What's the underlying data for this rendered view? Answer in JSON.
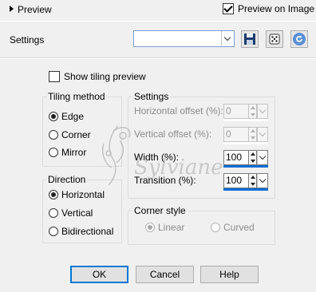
{
  "preview_bar": {
    "toggle_label": "Preview",
    "preview_on_image_label": "Preview on Image",
    "preview_on_image_checked": true
  },
  "settings_row": {
    "label": "Settings",
    "preset_value": "",
    "buttons": {
      "save": "save-icon",
      "random": "dice-icon",
      "reset": "reset-icon"
    }
  },
  "show_tiling_preview": {
    "label": "Show tiling preview",
    "checked": false
  },
  "tiling_method": {
    "title": "Tiling method",
    "options": [
      {
        "label": "Edge",
        "selected": true
      },
      {
        "label": "Corner",
        "selected": false
      },
      {
        "label": "Mirror",
        "selected": false
      }
    ]
  },
  "direction": {
    "title": "Direction",
    "options": [
      {
        "label": "Horizontal",
        "selected": true
      },
      {
        "label": "Vertical",
        "selected": false
      },
      {
        "label": "Bidirectional",
        "selected": false
      }
    ]
  },
  "settings_group": {
    "title": "Settings",
    "fields": [
      {
        "label": "Horizontal offset (%):",
        "value": "0",
        "enabled": false,
        "level_fraction": 0.0
      },
      {
        "label": "Vertical offset (%):",
        "value": "0",
        "enabled": false,
        "level_fraction": 0.0
      },
      {
        "label": "Width (%):",
        "value": "100",
        "enabled": true,
        "level_fraction": 1.0
      },
      {
        "label": "Transition (%):",
        "value": "100",
        "enabled": true,
        "level_fraction": 1.0
      }
    ]
  },
  "corner_style": {
    "title": "Corner style",
    "options": [
      {
        "label": "Linear",
        "selected": true
      },
      {
        "label": "Curved",
        "selected": false
      }
    ]
  },
  "footer": {
    "ok": "OK",
    "cancel": "Cancel",
    "help": "Help"
  },
  "watermark_text": "Sylviane",
  "colors": {
    "accent": "#0078d7",
    "level_fill": "#0d6dd6",
    "background": "#f0f0f0"
  }
}
